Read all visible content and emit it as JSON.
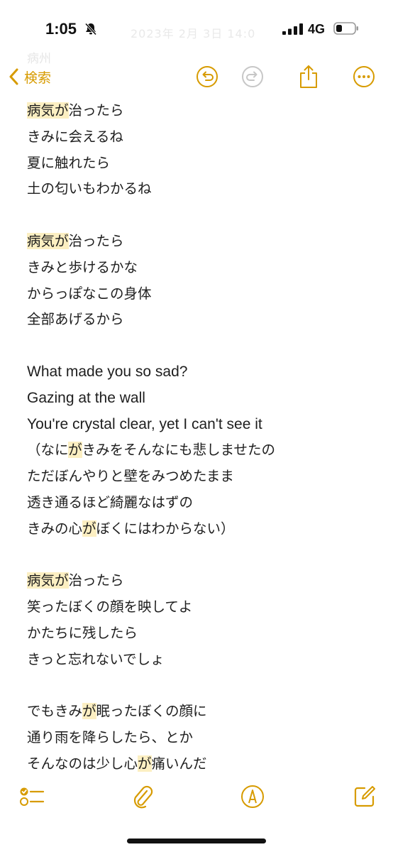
{
  "status": {
    "time": "1:05",
    "network": "4G",
    "faint_date": "2023年 2月 3日 14:0",
    "faint_sub": "病州"
  },
  "nav": {
    "back_label": "検索"
  },
  "note": {
    "lines": [
      [
        {
          "t": "病気が",
          "hl": true
        },
        {
          "t": "治ったら"
        }
      ],
      [
        {
          "t": "きみに会えるね"
        }
      ],
      [
        {
          "t": "夏に触れたら"
        }
      ],
      [
        {
          "t": "土の匂いもわかるね"
        }
      ],
      [],
      [
        {
          "t": "病気が",
          "hl": true
        },
        {
          "t": "治ったら"
        }
      ],
      [
        {
          "t": "きみと歩けるかな"
        }
      ],
      [
        {
          "t": "からっぽなこの身体"
        }
      ],
      [
        {
          "t": "全部あげるから"
        }
      ],
      [],
      [
        {
          "t": "What made you so sad?",
          "latin": true
        }
      ],
      [
        {
          "t": "Gazing at the wall",
          "latin": true
        }
      ],
      [
        {
          "t": "You're crystal clear, yet I can't see it",
          "latin": true
        }
      ],
      [
        {
          "t": "（なに"
        },
        {
          "t": "が",
          "hl": true
        },
        {
          "t": "きみをそんなにも悲しませたの"
        }
      ],
      [
        {
          "t": "ただぼんやりと壁をみつめたまま"
        }
      ],
      [
        {
          "t": "透き通るほど綺麗なはずの"
        }
      ],
      [
        {
          "t": "きみの心"
        },
        {
          "t": "が",
          "hl": true
        },
        {
          "t": "ぼくにはわからない）"
        }
      ],
      [],
      [
        {
          "t": "病気が",
          "hl": true
        },
        {
          "t": "治ったら"
        }
      ],
      [
        {
          "t": "笑ったぼくの顔を映してよ"
        }
      ],
      [
        {
          "t": "かたちに残したら"
        }
      ],
      [
        {
          "t": "きっと忘れないでしょ"
        }
      ],
      [],
      [
        {
          "t": "でもきみ"
        },
        {
          "t": "が",
          "hl": true
        },
        {
          "t": "眠ったぼくの顔に"
        }
      ],
      [
        {
          "t": "通り雨を降らしたら、とか"
        }
      ],
      [
        {
          "t": "そんなのは少し心"
        },
        {
          "t": "が",
          "hl": true
        },
        {
          "t": "痛いんだ"
        }
      ]
    ]
  },
  "colors": {
    "accent": "#d79b00",
    "highlight": "#fcefc2",
    "disabled": "#c7c7c7"
  },
  "icons": {
    "back": "chevron-left-icon",
    "undo": "undo-icon",
    "redo": "redo-icon",
    "share": "share-icon",
    "more": "more-icon",
    "checklist": "checklist-icon",
    "attach": "paperclip-icon",
    "markup": "markup-pen-icon",
    "compose": "compose-icon"
  }
}
